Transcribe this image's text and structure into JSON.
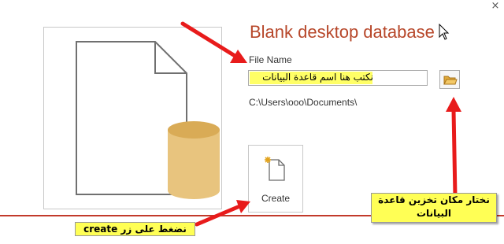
{
  "dialog": {
    "title": "Blank desktop database",
    "close_glyph": "×"
  },
  "form": {
    "file_name_label": "File Name",
    "file_name_value": "نكتب هنا اسم قاعدة البيانات",
    "save_path": "C:\\Users\\ooo\\Documents\\",
    "create_label": "Create"
  },
  "annotations": {
    "create_note": "نضغط على زر create",
    "folder_note": "نختار مكان تخزين قاعدة البيانات"
  },
  "icons": {
    "browse": "folder-icon",
    "create": "new-document-icon",
    "preview": "database-document-icon"
  },
  "colors": {
    "title": "#b7472a",
    "border_accent": "#c23a2b",
    "highlight": "#ffff66",
    "arrow": "#e81b1b"
  }
}
